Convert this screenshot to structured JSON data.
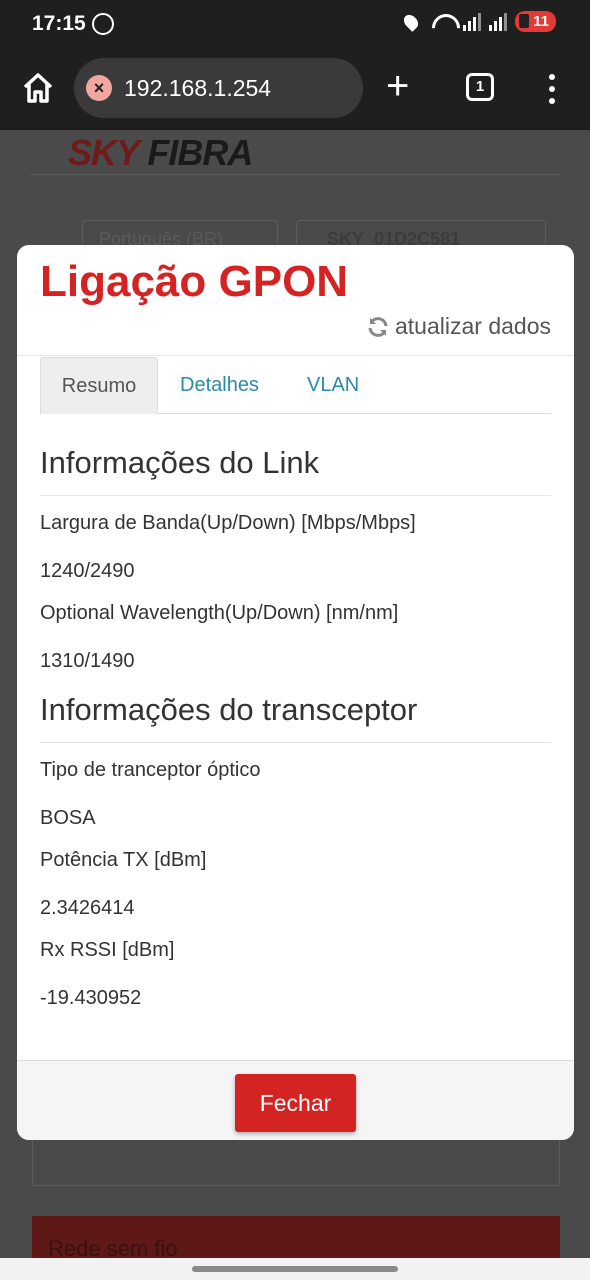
{
  "status_bar": {
    "time": "17:15",
    "battery": "11",
    "icons": [
      "whatsapp-icon",
      "location-icon",
      "wifi-icon",
      "signal-icon",
      "battery-icon"
    ]
  },
  "browser": {
    "url": "192.168.1.254",
    "tab_count": "1",
    "icons": [
      "home-icon",
      "not-secure-icon",
      "new-tab-icon",
      "tabs-icon",
      "menu-icon"
    ]
  },
  "background_page": {
    "logo_sky": "SKY",
    "logo_fibra": "FIBRA",
    "language_select": "Português (BR)",
    "network_select": "SKY_01D2C581",
    "section_label": "Rede sem fio",
    "accent_color": "#6e1b1b"
  },
  "modal": {
    "title": "Ligação GPON",
    "refresh_label": "atualizar dados",
    "tabs": [
      {
        "label": "Resumo",
        "active": true
      },
      {
        "label": "Detalhes",
        "active": false
      },
      {
        "label": "VLAN",
        "active": false
      }
    ],
    "link_section": {
      "heading": "Informações do Link",
      "fields": [
        {
          "label": "Largura de Banda(Up/Down) [Mbps/Mbps]",
          "value": "1240/2490"
        },
        {
          "label": "Optional Wavelength(Up/Down) [nm/nm]",
          "value": "1310/1490"
        }
      ]
    },
    "transceiver_section": {
      "heading": "Informações do transceptor",
      "fields": [
        {
          "label": "Tipo de tranceptor óptico",
          "value": "BOSA"
        },
        {
          "label": "Potência TX [dBm]",
          "value": "2.3426414"
        },
        {
          "label": "Rx RSSI [dBm]",
          "value": "-19.430952"
        }
      ]
    },
    "close_label": "Fechar",
    "title_color": "#d42323",
    "tab_link_color": "#2a8aa8"
  }
}
